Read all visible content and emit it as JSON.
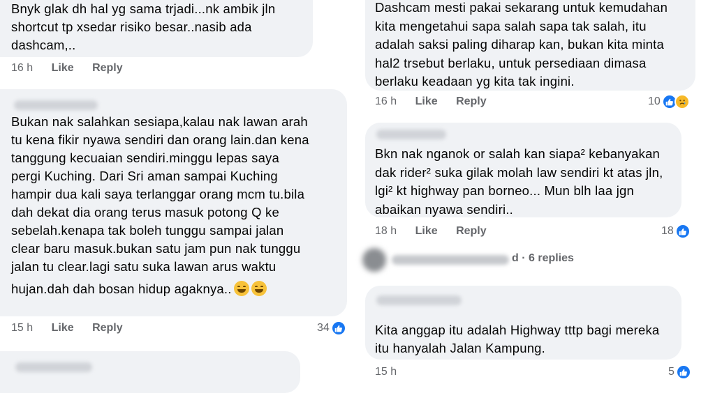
{
  "left": {
    "comment1": {
      "lines": [
        "Bnyk glak dh hal yg sama trjadi...nk ambik jln",
        "shortcut tp xsedar risiko besar..nasib ada",
        "dashcam,.."
      ],
      "time": "16 h",
      "like": "Like",
      "reply": "Reply"
    },
    "comment2": {
      "lines": [
        "Bukan nak salahkan sesiapa,kalau nak lawan arah",
        "tu kena fikir nyawa sendiri dan orang lain.dan kena",
        "tanggung kecuaian sendiri.minggu lepas saya",
        "pergi Kuching. Dari Sri aman sampai Kuching",
        "hampir dua kali saya terlanggar orang mcm tu.bila",
        "dah dekat dia orang terus masuk potong Q ke",
        "sebelah.kenapa tak boleh tunggu sampai jalan",
        "clear baru masuk.bukan satu jam pun nak tunggu",
        "jalan tu clear.lagi satu suka lawan arus waktu",
        "hujan.dah dah bosan hidup agaknya.."
      ],
      "time": "15 h",
      "like": "Like",
      "reply": "Reply",
      "reactions": "34",
      "emoji": "laughing-face-icon"
    }
  },
  "right": {
    "comment1": {
      "lines": [
        "Dashcam mesti pakai sekarang untuk kemudahan",
        "kita mengetahui sapa salah sapa tak salah, itu",
        "adalah saksi paling diharap kan, bukan kita minta",
        "hal2 trsebut berlaku, untuk persediaan dimasa",
        "berlaku keadaan yg kita tak ingini."
      ],
      "time": "16 h",
      "like": "Like",
      "reply": "Reply",
      "reactions": "10"
    },
    "comment2": {
      "lines": [
        "Bkn nak nganok or salah kan siapa² kebanyakan",
        "dak rider² suka gilak molah law sendiri kt atas jln,",
        "lgi² kt highway pan borneo... Mun blh laa jgn",
        "abaikan nyawa sendiri.."
      ],
      "time": "18 h",
      "like": "Like",
      "reply": "Reply",
      "reactions": "18"
    },
    "replies": {
      "text": "d · 6 replies"
    },
    "comment3": {
      "lines": [
        "Kita anggap itu adalah Highway tttp bagi mereka",
        "itu hanyalah Jalan Kampung."
      ],
      "time": "15 h",
      "reactions": "5"
    }
  },
  "colors": {
    "bubble": "#f0f2f5",
    "meta": "#65676b",
    "like_blue": "#1877f2",
    "text": "#050505"
  }
}
